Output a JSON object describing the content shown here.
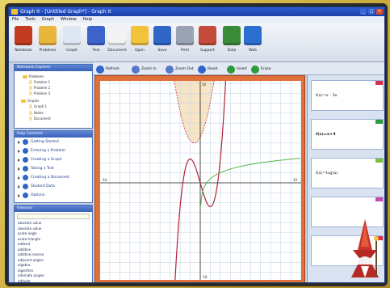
{
  "window": {
    "title": "Graph It - [Untitled Graph*] - Graph It"
  },
  "menu": [
    "File",
    "Tools",
    "Graph",
    "Window",
    "Help"
  ],
  "toolbar": [
    {
      "label": "Notebook",
      "icon": "notebook-icon",
      "color": "#c23b22"
    },
    {
      "label": "Problems",
      "icon": "pencil-icon",
      "color": "#e9b63c"
    },
    {
      "label": "Graph",
      "icon": "graph-page-icon",
      "color": "#dfe6f3"
    },
    {
      "label": "Text",
      "icon": "text-icon",
      "color": "#3b63c9"
    },
    {
      "label": "Document",
      "icon": "document-icon",
      "color": "#f3f3f3"
    },
    {
      "label": "Open",
      "icon": "folder-icon",
      "color": "#f2c23a"
    },
    {
      "label": "Save",
      "icon": "save-icon",
      "color": "#2f66c8"
    },
    {
      "label": "Print",
      "icon": "print-icon",
      "color": "#9aa3b3"
    },
    {
      "label": "Support",
      "icon": "people-icon",
      "color": "#c44a3a"
    },
    {
      "label": "Data",
      "icon": "bar-chart-icon",
      "color": "#3a8a3a"
    },
    {
      "label": "Web",
      "icon": "globe-icon",
      "color": "#2b6fd0"
    }
  ],
  "subtoolbar": [
    {
      "label": "Refresh",
      "icon": "refresh-icon",
      "color": "#2f66c8"
    },
    {
      "label": "Zoom In",
      "icon": "zoom-in-icon",
      "color": "#5577cc"
    },
    {
      "label": "Zoom Out",
      "icon": "zoom-out-icon",
      "color": "#5577cc"
    },
    {
      "label": "Reset",
      "icon": "reset-icon",
      "color": "#2f66c8"
    },
    {
      "label": "Insert",
      "icon": "insert-icon",
      "color": "#2f9a3a"
    },
    {
      "label": "Erase",
      "icon": "erase-icon",
      "color": "#2f9a3a"
    }
  ],
  "explorer": {
    "title": "Notebook Explorer",
    "items": [
      "Problems",
      "Problem 1",
      "Problem 2",
      "Problem 3",
      "Graphs",
      "Graph 1",
      "Notes",
      "Document"
    ]
  },
  "help": {
    "title": "Help Contents",
    "items": [
      "Getting Started",
      "Entering a Problem",
      "Creating a Graph",
      "Taking a Test",
      "Creating a Document",
      "Student Data",
      "Options"
    ]
  },
  "glossary": {
    "title": "Glossary",
    "search_value": "",
    "items": [
      "absolute value",
      "absolute value",
      "acute angle",
      "acute triangle",
      "addend",
      "addition",
      "additive inverse",
      "adjacent angles",
      "algebra",
      "algorithm",
      "alternate angles",
      "altitude"
    ]
  },
  "functions": [
    {
      "expr": "f(x)=x - 3x",
      "tab_color": "#d8304a",
      "bold": false
    },
    {
      "expr": "f(x)=x+4",
      "tab_color": "#2f9a3a",
      "bold": true
    },
    {
      "expr": "f(x)=log(x)",
      "tab_color": "#7bbf3a",
      "bold": false
    },
    {
      "expr": "",
      "tab_color": "#c64ab0",
      "bold": false
    },
    {
      "expr": "",
      "tab_color": "#d8304a",
      "bold": false
    }
  ],
  "graph": {
    "x_tick_left": "-10",
    "x_tick_right": "10",
    "y_tick_top": "10",
    "y_tick_bottom": "-10",
    "colors": {
      "cubic": "#b0223a",
      "parabola": "#c0304a",
      "log": "#53b34a",
      "shade": "#f6e4c4",
      "grid": "#c9d7e8",
      "frame": "#e0703a"
    }
  },
  "colors": {
    "titlebar": "#1a3fa8",
    "pane_header": "#3a63b8"
  }
}
